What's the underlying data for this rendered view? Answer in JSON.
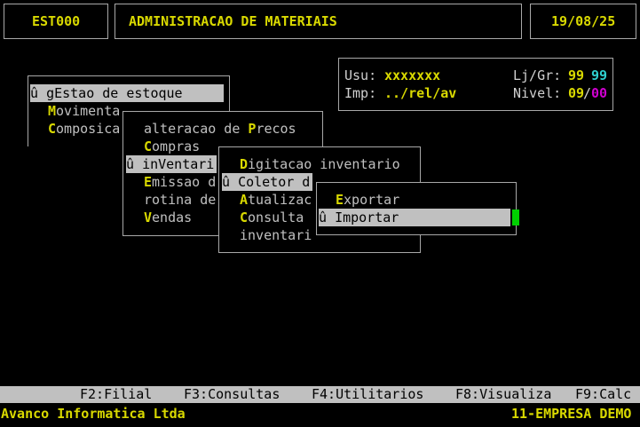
{
  "header": {
    "program_code": "EST000",
    "title": "ADMINISTRACAO DE MATERIAIS",
    "date": "19/08/25"
  },
  "info": {
    "user_label": "Usu:",
    "user_value": "xxxxxxx",
    "printer_label": "Imp:",
    "printer_value": "../rel/av",
    "store_label": "Lj/Gr:",
    "store_value": "99",
    "group_value": "99",
    "level_label": "Nivel:",
    "level_value": "09",
    "level_sep": "/",
    "level_value2": "00"
  },
  "menu1": {
    "items": [
      {
        "marker": "û ",
        "hot": "",
        "prefix": "g",
        "hotkey": "E",
        "rest": "stao de estoque  "
      },
      {
        "hot": "M",
        "rest": "ovimenta"
      },
      {
        "hot": "C",
        "rest": "omposica"
      }
    ]
  },
  "menu2": {
    "items": [
      {
        "prefix": "alteracao de ",
        "hot": "P",
        "rest": "recos"
      },
      {
        "hot": "C",
        "rest": "ompras"
      },
      {
        "marker": "û ",
        "prefix": "in",
        "hot": "V",
        "rest": "entari"
      },
      {
        "hot": "E",
        "rest": "missao d"
      },
      {
        "prefix": "rotina de",
        "hot": "",
        "rest": ""
      },
      {
        "hot": "V",
        "rest": "endas"
      }
    ]
  },
  "menu3": {
    "items": [
      {
        "hot": "D",
        "rest": "igitacao inventario"
      },
      {
        "marker": "û ",
        "hot": "C",
        "rest": "oletor d"
      },
      {
        "hot": "A",
        "rest": "tualizac"
      },
      {
        "hot": "C",
        "rest": "onsulta"
      },
      {
        "prefix": "inventari",
        "hot": "",
        "rest": ""
      }
    ]
  },
  "menu4": {
    "items": [
      {
        "hot": "E",
        "rest": "xportar"
      },
      {
        "marker": "û ",
        "hot": "I",
        "rest": "mportar"
      }
    ]
  },
  "function_bar": {
    "keys": [
      "F2:Filial",
      "F3:Consultas",
      "F4:Utilitarios",
      "F8:Visualiza",
      "F9:Calc"
    ]
  },
  "status": {
    "company_left": "Avanco Informatica Ltda",
    "company_right": "11-EMPRESA DEMO"
  },
  "colors": {
    "background": "#000000",
    "yellow": "#d9d900",
    "cyan": "#2fd0d0",
    "magenta": "#d000d0",
    "highlight": "#c0c0c0",
    "cursor": "#00d000"
  }
}
